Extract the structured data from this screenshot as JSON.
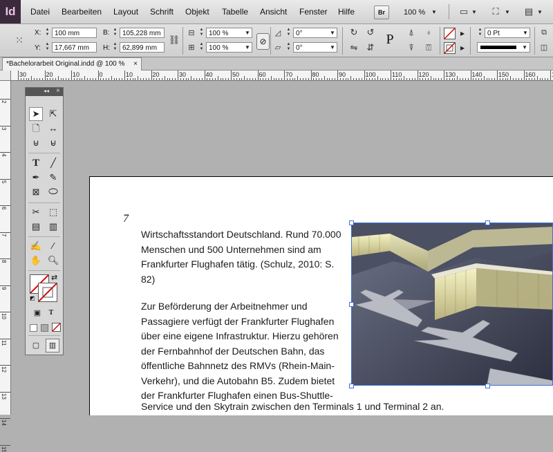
{
  "app": {
    "logo": "Id"
  },
  "menu": {
    "items": [
      "Datei",
      "Bearbeiten",
      "Layout",
      "Schrift",
      "Objekt",
      "Tabelle",
      "Ansicht",
      "Fenster",
      "Hilfe"
    ],
    "bridge_label": "Br",
    "zoom": "100 %"
  },
  "control": {
    "x_label": "X:",
    "x_value": "100 mm",
    "y_label": "Y:",
    "y_value": "17,667 mm",
    "w_label": "B:",
    "w_value": "105,228 mm",
    "h_label": "H:",
    "h_value": "62,899 mm",
    "scale_x": "100 %",
    "scale_y": "100 %",
    "rotate": "0°",
    "shear": "0°",
    "stroke_weight": "0 Pt"
  },
  "tab": {
    "title": "*Bachelorarbeit Original.indd @ 100 %",
    "close": "×"
  },
  "ruler": {
    "h_labels": [
      "30",
      "20",
      "10",
      "0",
      "10",
      "20",
      "30",
      "40",
      "50",
      "60",
      "70",
      "80",
      "90",
      "100",
      "110",
      "120",
      "130",
      "140",
      "150",
      "160",
      "170"
    ],
    "v_labels": [
      "2",
      "3",
      "4",
      "5",
      "6",
      "7",
      "8",
      "9",
      "10",
      "11",
      "12",
      "13",
      "14",
      "15"
    ]
  },
  "document": {
    "page_number": "7",
    "para1": "Wirtschaftsstandort Deutschland. Rund 70.000 Menschen und 500 Unternehmen sind am Frankfurter Flughafen tätig. (Schulz, 2010: S. 82)",
    "para2": "Zur Beförderung der Arbeitnehmer und Passagiere verfügt der Frankfurter Flughafen über eine eigene Infrastruktur. Hierzu gehören der Fernbahnhof der Deutschen Bahn, das öffentliche Bahnnetz des RMVs (Rhein-Main-Verkehr), und die Autobahn B5. Zudem bietet der Frankfurter Flughafen einen Bus-Shuttle-",
    "para3": "Service und den Skytrain zwischen den Terminals 1 und Terminal 2 an."
  },
  "icons": [
    "selection-tool-icon",
    "direct-selection-tool-icon",
    "page-tool-icon",
    "gap-tool-icon",
    "type-tool-icon",
    "line-tool-icon",
    "pen-tool-icon",
    "pencil-tool-icon",
    "rectangle-frame-tool-icon",
    "ellipse-tool-icon",
    "scissors-tool-icon",
    "free-transform-tool-icon",
    "gradient-swatch-tool-icon",
    "gradient-feather-tool-icon",
    "note-tool-icon",
    "eyedropper-tool-icon",
    "hand-tool-icon",
    "zoom-tool-icon"
  ],
  "colors": {
    "selection": "#3b6fd6",
    "pasteboard": "#b1b1b1",
    "logo_bg": "#3b2a3b"
  }
}
